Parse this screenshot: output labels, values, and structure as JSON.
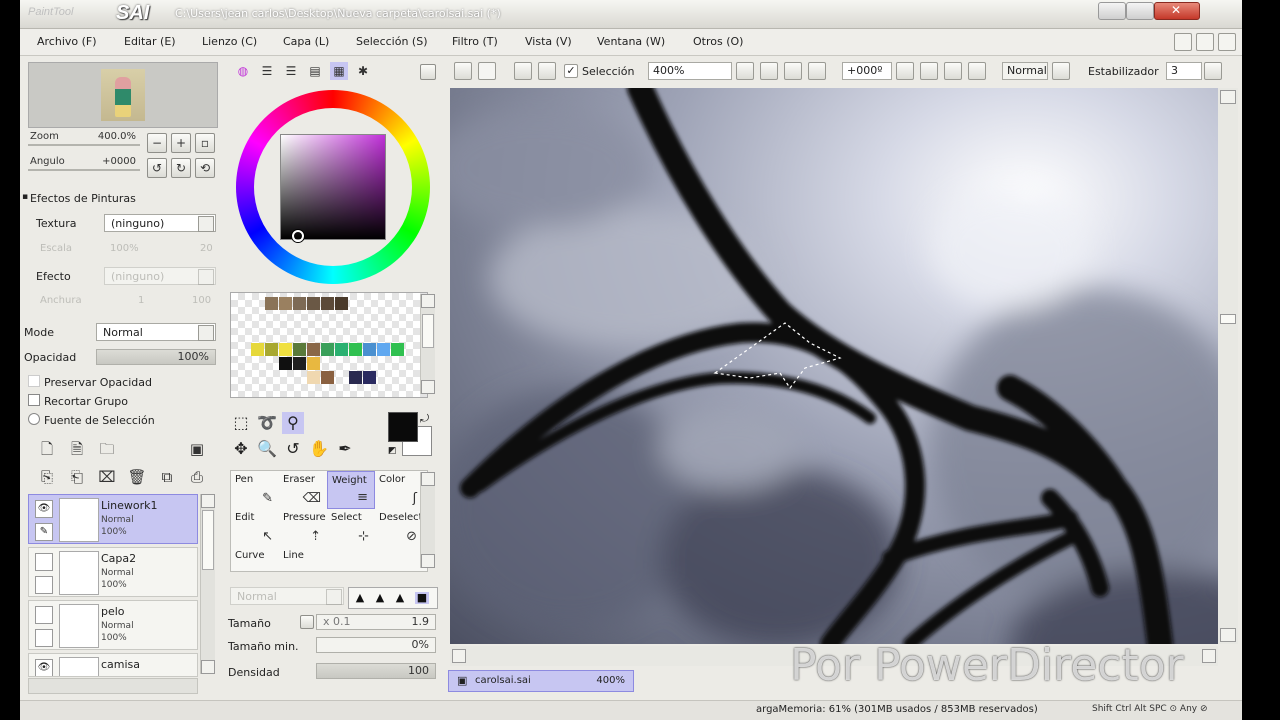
{
  "app": {
    "logo_text": "PaintTool",
    "logo_sai": "SAI",
    "title": "C:\\Users\\jean carlos\\Desktop\\Nueva carpeta\\carolsai.sai (*)"
  },
  "menu": [
    "Archivo (F)",
    "Editar (E)",
    "Lienzo (C)",
    "Capa (L)",
    "Selección (S)",
    "Filtro (T)",
    "Vista (V)",
    "Ventana (W)",
    "Otros (O)"
  ],
  "navigator": {
    "zoom_label": "Zoom",
    "zoom_value": "400.0%",
    "angle_label": "Angulo",
    "angle_value": "+0000"
  },
  "effects": {
    "title": "Efectos de Pinturas",
    "texture_label": "Textura",
    "texture_value": "(ninguno)",
    "scale_label": "Escala",
    "scale_value": "100%",
    "scale_num": "20",
    "effect_label": "Efecto",
    "effect_value": "(ninguno)",
    "width_label": "Anchura",
    "width_value": "1",
    "width_num": "100"
  },
  "layer_props": {
    "mode_label": "Mode",
    "mode_value": "Normal",
    "opacity_label": "Opacidad",
    "opacity_value": "100%",
    "preserve_opacity": "Preservar Opacidad",
    "clip_group": "Recortar Grupo",
    "selection_source": "Fuente de Selección"
  },
  "layers": [
    {
      "name": "Linework1",
      "mode": "Normal",
      "opacity": "100%"
    },
    {
      "name": "Capa2",
      "mode": "Normal",
      "opacity": "100%"
    },
    {
      "name": "pelo",
      "mode": "Normal",
      "opacity": "100%"
    },
    {
      "name": "camisa"
    }
  ],
  "brushes": [
    {
      "label": "Pen"
    },
    {
      "label": "Eraser"
    },
    {
      "label": "Weight"
    },
    {
      "label": "Color"
    },
    {
      "label": "Edit"
    },
    {
      "label": "Pressure"
    },
    {
      "label": "Select"
    },
    {
      "label": "Deselect"
    },
    {
      "label": "Curve"
    },
    {
      "label": "Line"
    }
  ],
  "brush_params": {
    "blend_mode": "Normal",
    "size_label": "Tamaño",
    "size_mult": "x 0.1",
    "size_value": "1.9",
    "min_size_label": "Tamaño min.",
    "min_size_value": "0%",
    "density_label": "Densidad",
    "density_value": "100"
  },
  "canvas_toolbar": {
    "selection_label": "Selección",
    "zoom_value": "400%",
    "angle_value": "+000º",
    "mode_value": "Normal",
    "stabilizer_label": "Estabilizador",
    "stabilizer_value": "3"
  },
  "doc_tab": {
    "name": "carolsai.sai",
    "zoom": "400%"
  },
  "status": {
    "memory": "argaMemoria: 61% (301MB usados / 853MB reservados)",
    "keys": "Shift Ctrl Alt SPC ⊙ Any ⊘"
  },
  "watermark": "Por PowerDirector",
  "icons": [
    "eye-icon",
    "pen-icon",
    "new-layer-icon",
    "delete-icon",
    "move-icon",
    "zoom-icon",
    "rotate-icon",
    "hand-icon",
    "eyedropper-icon"
  ]
}
